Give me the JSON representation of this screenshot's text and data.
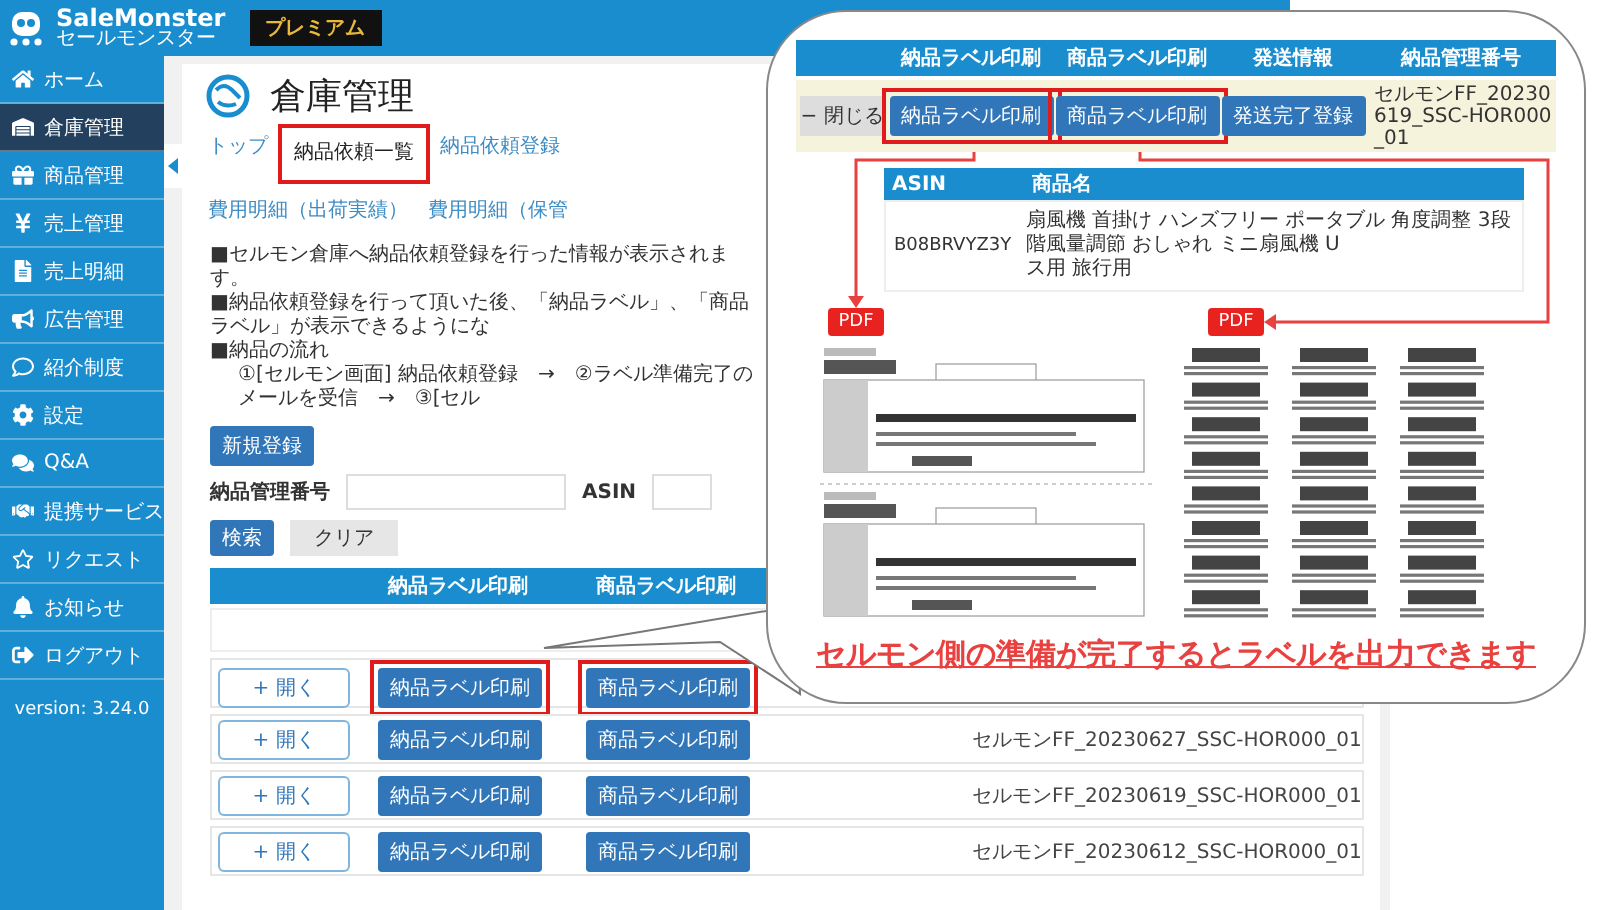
{
  "app": {
    "logo": "SaleMonster",
    "logo_sub": "セールモンスター",
    "plan_badge": "プレミアム"
  },
  "sidebar": {
    "items": [
      {
        "label": "ホーム",
        "selected": false
      },
      {
        "label": "倉庫管理",
        "selected": true
      },
      {
        "label": "商品管理",
        "selected": false
      },
      {
        "label": "売上管理",
        "selected": false
      },
      {
        "label": "売上明細",
        "selected": false
      },
      {
        "label": "広告管理",
        "selected": false
      },
      {
        "label": "紹介制度",
        "selected": false
      },
      {
        "label": "設定",
        "selected": false
      },
      {
        "label": "Q&A",
        "selected": false
      },
      {
        "label": "提携サービス",
        "selected": false
      },
      {
        "label": "リクエスト",
        "selected": false
      },
      {
        "label": "お知らせ",
        "selected": false
      },
      {
        "label": "ログアウト",
        "selected": false
      }
    ],
    "version": "version: 3.24.0"
  },
  "page": {
    "title": "倉庫管理",
    "tabs": [
      {
        "label": "トップ",
        "selected": false,
        "highlighted": false
      },
      {
        "label": "納品依頼一覧",
        "selected": true,
        "highlighted": true
      },
      {
        "label": "納品依頼登録",
        "selected": false,
        "highlighted": false
      },
      {
        "label": "費用明細（出荷実績）",
        "selected": false,
        "highlighted": false
      },
      {
        "label": "費用明細（保管",
        "selected": false,
        "highlighted": false
      }
    ],
    "notes": [
      {
        "text": "■セルモン倉庫へ納品依頼登録を行った情報が表示されます。",
        "indent": false
      },
      {
        "text": "■納品依頼登録を行って頂いた後、「納品ラベル」、「商品ラベル」が表示できるようにな",
        "indent": false
      },
      {
        "text": "■納品の流れ",
        "indent": false
      },
      {
        "text": "①[セルモン画面] 納品依頼登録　→　②ラベル準備完了のメールを受信　→　③[セル",
        "indent": true
      }
    ],
    "new_button": "新規登録",
    "filters": [
      {
        "label": "納品管理番号"
      },
      {
        "label": "ASIN"
      }
    ],
    "search_button": "検索",
    "clear_button": "クリア",
    "table": {
      "columns": [
        "納品ラベル印刷",
        "商品ラベル印刷"
      ],
      "rows": [
        {
          "open_button": "+ 開く",
          "buttons": [
            {
              "label": "納品ラベル印刷",
              "highlighted": true
            },
            {
              "label": "商品ラベル印刷",
              "highlighted": true
            }
          ]
        },
        {
          "open_button": "+ 開く",
          "buttons": [
            {
              "label": "納品ラベル印刷",
              "highlighted": false
            },
            {
              "label": "商品ラベル印刷",
              "highlighted": false
            }
          ],
          "reference": "セルモンFF_20230627_SSC-HOR000_01"
        },
        {
          "open_button": "+ 開く",
          "buttons": [
            {
              "label": "納品ラベル印刷",
              "highlighted": false
            },
            {
              "label": "商品ラベル印刷",
              "highlighted": false
            }
          ],
          "reference": "セルモンFF_20230619_SSC-HOR000_01"
        },
        {
          "open_button": "+ 開く",
          "buttons": [
            {
              "label": "納品ラベル印刷",
              "highlighted": false
            },
            {
              "label": "商品ラベル印刷",
              "highlighted": false
            }
          ],
          "reference": "セルモンFF_20230612_SSC-HOR000_01"
        }
      ]
    }
  },
  "callout": {
    "columns": [
      "納品ラベル印刷",
      "商品ラベル印刷",
      "発送情報",
      "納品管理番号"
    ],
    "close_button": "− 閉じる",
    "buttons": [
      {
        "label": "納品ラベル印刷",
        "highlighted": true
      },
      {
        "label": "商品ラベル印刷",
        "highlighted": true
      },
      {
        "label": "発送完了登録",
        "highlighted": false
      }
    ],
    "reference": "セルモンFF_20230619_SSC-HOR000_01",
    "items": {
      "columns": [
        "ASIN",
        "商品名"
      ],
      "rows": [
        {
          "asin": "B08BRVYZ3Y",
          "name_lines": [
            "扇風機 首掛け ハンズフリー ポータブル 角度調整 3段階風量調節 おしゃれ ミニ扇風機 U",
            "ス用 旅行用"
          ]
        }
      ]
    },
    "badges": [
      "PDF",
      "PDF"
    ],
    "message": "セルモン側の準備が完了するとラベルを出力できます"
  }
}
